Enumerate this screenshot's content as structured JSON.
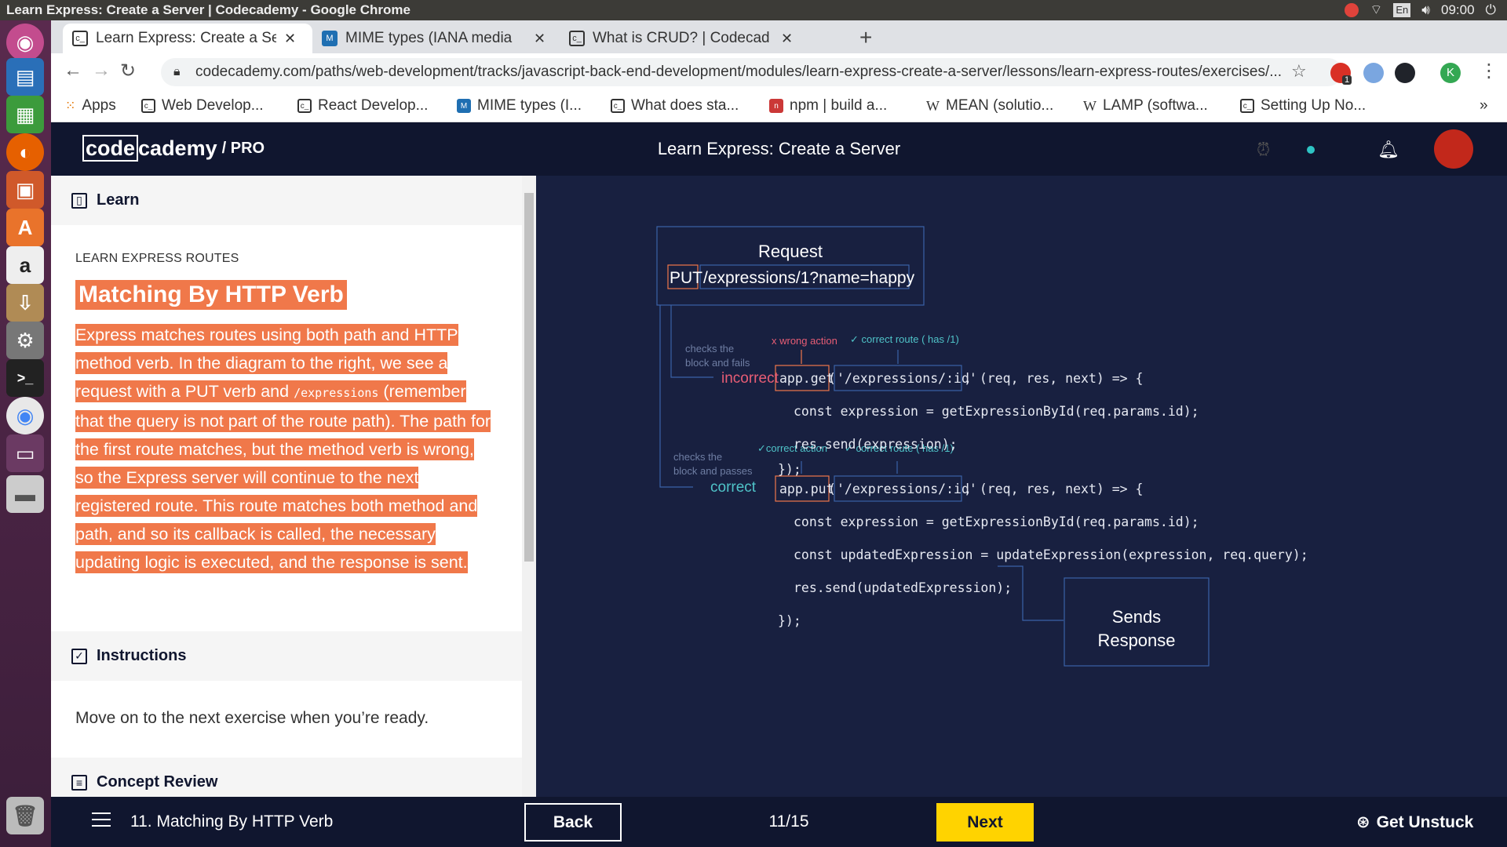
{
  "os": {
    "window_title": "Learn Express: Create a Server | Codecademy - Google Chrome",
    "clock": "09:00",
    "keyboard": "En"
  },
  "browser": {
    "tabs": [
      {
        "favicon": "c_",
        "title": "Learn Express: Create a Se"
      },
      {
        "favicon": "M",
        "title": "MIME types (IANA media"
      },
      {
        "favicon": "c_",
        "title": "What is CRUD? | Codecad"
      }
    ],
    "url": "codecademy.com/paths/web-development/tracks/javascript-back-end-development/modules/learn-express-create-a-server/lessons/learn-express-routes/exercises/...",
    "bookmarks": [
      {
        "icon": "apps-icon",
        "label": "Apps"
      },
      {
        "icon": "c_",
        "label": "Web Develop..."
      },
      {
        "icon": "c_",
        "label": "React Develop..."
      },
      {
        "icon": "M",
        "label": "MIME types (I..."
      },
      {
        "icon": "c_",
        "label": "What does sta..."
      },
      {
        "icon": "n",
        "label": "npm | build a..."
      },
      {
        "icon": "W",
        "label": "MEAN (solutio..."
      },
      {
        "icon": "W",
        "label": "LAMP (softwa..."
      },
      {
        "icon": "c_",
        "label": "Setting Up No..."
      }
    ],
    "overflow": "»",
    "profile_initial": "K",
    "extension_badge": "1"
  },
  "codecademy": {
    "logo_code": "code",
    "logo_cademy": "cademy",
    "logo_pro": "/ PRO",
    "course_title": "Learn Express: Create a Server"
  },
  "lesson": {
    "learn_label": "Learn",
    "kicker": "LEARN EXPRESS ROUTES",
    "title": "Matching By HTTP Verb",
    "body_1": "Express matches routes using both path and HTTP method verb. In the diagram to the right, we see a request with a PUT verb and ",
    "body_code": "/expressions",
    "body_2": " (remember that the query is not part of the route path). The path for the first route matches, but the method verb is wrong, so the Express server will continue to the next registered route. This route matches both method and path, and so its callback is called, the necessary updating logic is executed, and the response is sent.",
    "instructions_label": "Instructions",
    "instructions_text": "Move on to the next exercise when you’re ready.",
    "concept_review_label": "Concept Review"
  },
  "diagram": {
    "request_title": "Request",
    "request_verb": "PUT",
    "request_path": "/expressions/1?name=happy",
    "fail_note_1": "checks the",
    "fail_note_2": "block and fails",
    "incorrect_label": "incorrect",
    "wrong_action": "x wrong action",
    "correct_route_1": "✓ correct route ( has /1)",
    "get_method": "app.get",
    "get_paren": "(",
    "get_route": "'/expressions/:id'",
    "get_rest": ", (req, res, next) => {",
    "get_line1": "const expression = getExpressionById(req.params.id);",
    "get_line2": "res.send(expression);",
    "get_close": "});",
    "pass_note_1": "checks the",
    "pass_note_2": "block and passes",
    "correct_label": "correct",
    "correct_action": "✓correct action",
    "correct_route_2": "✓ correct route ( has /1)",
    "put_method": "app.put",
    "put_paren": "(",
    "put_route": "'/expressions/:id'",
    "put_rest": ", (req, res, next) => {",
    "put_line1": "const expression = getExpressionById(req.params.id);",
    "put_line2": "const updatedExpression = updateExpression(expression, req.query);",
    "put_line3": "res.send(updatedExpression);",
    "put_close": "});",
    "response_1": "Sends",
    "response_2": "Response"
  },
  "footer": {
    "lesson_name": "11. Matching By HTTP Verb",
    "back_label": "Back",
    "progress": "11/15",
    "next_label": "Next",
    "get_unstuck_label": "Get Unstuck"
  },
  "colors": {
    "accent_orange": "#f0784a",
    "next_yellow": "#ffd300",
    "navy": "#10162f",
    "diagram_bg": "#182040",
    "incorrect_red": "#e85d75",
    "correct_teal": "#4fc3c8"
  }
}
